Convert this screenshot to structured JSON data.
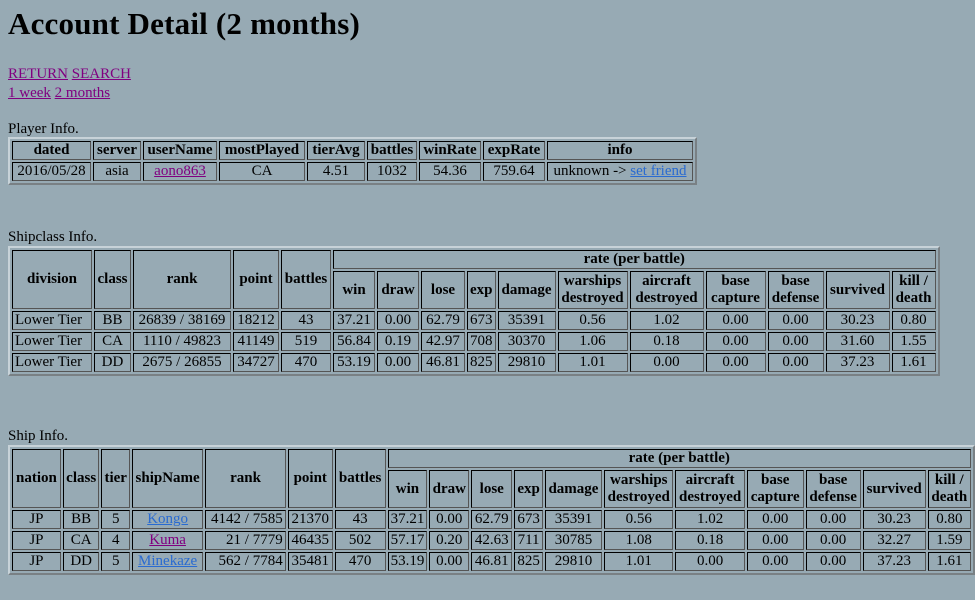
{
  "title": "Account Detail (2 months)",
  "nav": {
    "return_label": "RETURN",
    "search_label": "SEARCH",
    "week_label": "1 week",
    "months_label": "2 months"
  },
  "player": {
    "section_label": "Player Info.",
    "headers": [
      "dated",
      "server",
      "userName",
      "mostPlayed",
      "tierAvg",
      "battles",
      "winRate",
      "expRate",
      "info"
    ],
    "row": {
      "dated": "2016/05/28",
      "server": "asia",
      "userName": "aono863",
      "mostPlayed": "CA",
      "tierAvg": "4.51",
      "battles": "1032",
      "winRate": "54.36",
      "expRate": "759.64",
      "info_text": "unknown ->",
      "info_link": "set friend"
    }
  },
  "shipclass": {
    "section_label": "Shipclass Info.",
    "headers": {
      "division": "division",
      "class": "class",
      "rank": "rank",
      "point": "point",
      "battles": "battles",
      "rate": "rate (per battle)",
      "win": "win",
      "draw": "draw",
      "lose": "lose",
      "exp": "exp",
      "damage": "damage",
      "warships1": "warships",
      "warships2": "destroyed",
      "aircraft1": "aircraft",
      "aircraft2": "destroyed",
      "capture1": "base",
      "capture2": "capture",
      "defense1": "base",
      "defense2": "defense",
      "survived": "survived",
      "kd1": "kill /",
      "kd2": "death"
    },
    "rows": [
      {
        "division": "Lower Tier",
        "class": "BB",
        "rank": "26839 / 38169",
        "point": "18212",
        "battles": "43",
        "win": "37.21",
        "draw": "0.00",
        "lose": "62.79",
        "exp": "673",
        "damage": "35391",
        "warships": "0.56",
        "aircraft": "1.02",
        "capture": "0.00",
        "defense": "0.00",
        "survived": "30.23",
        "kd": "0.80"
      },
      {
        "division": "Lower Tier",
        "class": "CA",
        "rank": "1110 / 49823",
        "point": "41149",
        "battles": "519",
        "win": "56.84",
        "draw": "0.19",
        "lose": "42.97",
        "exp": "708",
        "damage": "30370",
        "warships": "1.06",
        "aircraft": "0.18",
        "capture": "0.00",
        "defense": "0.00",
        "survived": "31.60",
        "kd": "1.55"
      },
      {
        "division": "Lower Tier",
        "class": "DD",
        "rank": "2675 / 26855",
        "point": "34727",
        "battles": "470",
        "win": "53.19",
        "draw": "0.00",
        "lose": "46.81",
        "exp": "825",
        "damage": "29810",
        "warships": "1.01",
        "aircraft": "0.00",
        "capture": "0.00",
        "defense": "0.00",
        "survived": "37.23",
        "kd": "1.61"
      }
    ]
  },
  "ship": {
    "section_label": "Ship Info.",
    "headers": {
      "nation": "nation",
      "class": "class",
      "tier": "tier",
      "shipName": "shipName",
      "rank": "rank",
      "point": "point",
      "battles": "battles",
      "rate": "rate (per battle)",
      "win": "win",
      "draw": "draw",
      "lose": "lose",
      "exp": "exp",
      "damage": "damage",
      "warships1": "warships",
      "warships2": "destroyed",
      "aircraft1": "aircraft",
      "aircraft2": "destroyed",
      "capture1": "base",
      "capture2": "capture",
      "defense1": "base",
      "defense2": "defense",
      "survived": "survived",
      "kd1": "kill /",
      "kd2": "death"
    },
    "rows": [
      {
        "nation": "JP",
        "class": "BB",
        "tier": "5",
        "shipName": "Kongo",
        "rank": "4142 / 7585",
        "point": "21370",
        "battles": "43",
        "win": "37.21",
        "draw": "0.00",
        "lose": "62.79",
        "exp": "673",
        "damage": "35391",
        "warships": "0.56",
        "aircraft": "1.02",
        "capture": "0.00",
        "defense": "0.00",
        "survived": "30.23",
        "kd": "0.80"
      },
      {
        "nation": "JP",
        "class": "CA",
        "tier": "4",
        "shipName": "Kuma",
        "rank": "21 / 7779",
        "point": "46435",
        "battles": "502",
        "win": "57.17",
        "draw": "0.20",
        "lose": "42.63",
        "exp": "711",
        "damage": "30785",
        "warships": "1.08",
        "aircraft": "0.18",
        "capture": "0.00",
        "defense": "0.00",
        "survived": "32.27",
        "kd": "1.59"
      },
      {
        "nation": "JP",
        "class": "DD",
        "tier": "5",
        "shipName": "Minekaze",
        "rank": "562 / 7784",
        "point": "35481",
        "battles": "470",
        "win": "53.19",
        "draw": "0.00",
        "lose": "46.81",
        "exp": "825",
        "damage": "29810",
        "warships": "1.01",
        "aircraft": "0.00",
        "capture": "0.00",
        "defense": "0.00",
        "survived": "37.23",
        "kd": "1.61"
      }
    ]
  },
  "colors": {
    "background": "#97aab4",
    "visited_link": "#800080",
    "link": "#2a6bd1"
  }
}
